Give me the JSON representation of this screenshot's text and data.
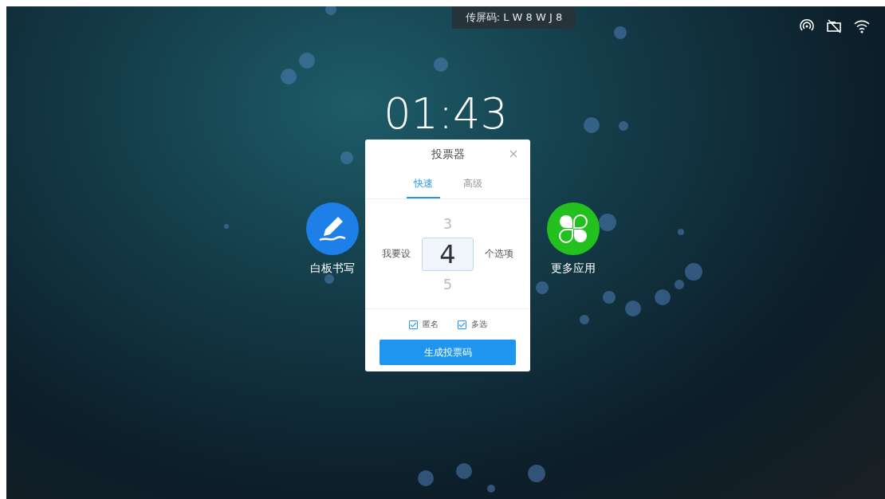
{
  "cast_code": {
    "text": "传屏码: L W 8 W J 8"
  },
  "clock": {
    "time": "01:43"
  },
  "apps": [
    {
      "kind": "whiteboard",
      "label": "白板书写"
    },
    {
      "kind": "more",
      "label": "更多应用"
    }
  ],
  "dialog": {
    "title": "投票器",
    "tabs": [
      {
        "label": "快速",
        "selected": true
      },
      {
        "label": "高级",
        "selected": false
      }
    ],
    "picker": {
      "prefix": "我要设",
      "suffix": "个选项",
      "items": [
        {
          "value": "3",
          "selected": false
        },
        {
          "value": "4",
          "selected": true
        },
        {
          "value": "5",
          "selected": false
        }
      ]
    },
    "options": [
      {
        "label": "匿名",
        "checked": true
      },
      {
        "label": "多选",
        "checked": true
      }
    ],
    "button": "生成投票码"
  }
}
